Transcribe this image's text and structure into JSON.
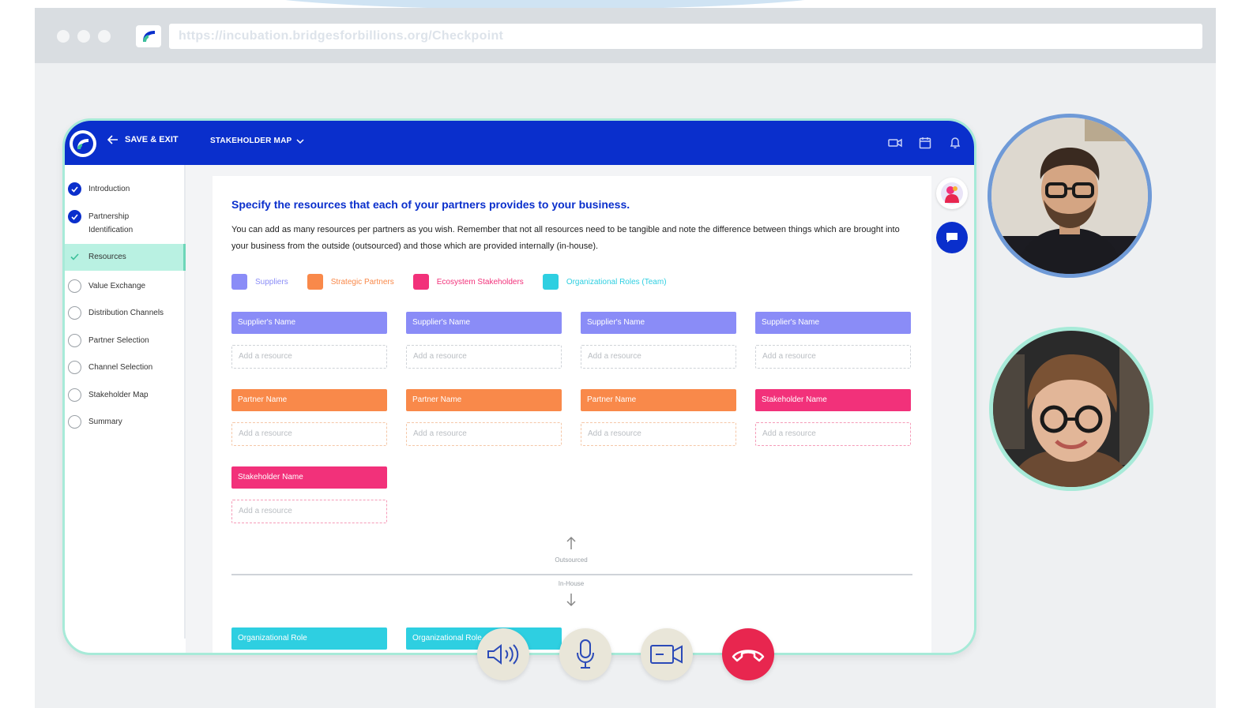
{
  "browser": {
    "url": "https://incubation.bridgesforbillions.org/Checkpoint"
  },
  "header": {
    "save_exit": "SAVE & EXIT",
    "map_title": "STAKEHOLDER MAP"
  },
  "sidebar": {
    "items": [
      {
        "label": "Introduction",
        "state": "done"
      },
      {
        "label": "Partnership Identification",
        "state": "done"
      },
      {
        "label": "Resources",
        "state": "active"
      },
      {
        "label": "Value Exchange",
        "state": "todo"
      },
      {
        "label": "Distribution Channels",
        "state": "todo"
      },
      {
        "label": "Partner Selection",
        "state": "todo"
      },
      {
        "label": "Channel Selection",
        "state": "todo"
      },
      {
        "label": "Stakeholder Map",
        "state": "todo"
      },
      {
        "label": "Summary",
        "state": "todo"
      }
    ]
  },
  "main": {
    "heading": "Specify the resources that each of your partners provides to your business.",
    "description": "You can add as many resources per partners as you wish. Remember that not all resources need to be tangible and note the difference between things which are brought into your business from the outside (outsourced) and those which are provided internally (in-house).",
    "legend": [
      {
        "label": "Suppliers",
        "color": "#8a8cf7"
      },
      {
        "label": "Strategic Partners",
        "color": "#f9894a"
      },
      {
        "label": "Ecosystem Stakeholders",
        "color": "#f2317a"
      },
      {
        "label": "Organizational Roles (Team)",
        "color": "#2ecfe1"
      }
    ],
    "add_resource_placeholder": "Add a resource",
    "cards": {
      "row1": [
        "Supplier's Name",
        "Supplier's Name",
        "Supplier's Name",
        "Supplier's Name"
      ],
      "row2": [
        "Partner Name",
        "Partner Name",
        "Partner Name",
        "Stakeholder Name"
      ],
      "row3": [
        "Stakeholder Name"
      ],
      "row4": [
        "Organizational Role",
        "Organizational Role"
      ]
    },
    "outsourced_label": "Outsourced",
    "inhouse_label": "In-House"
  },
  "colors": {
    "brand_blue": "#0a2fcc",
    "accent_mint": "#a7ead8",
    "hangup_red": "#e8264f"
  },
  "call_controls": [
    "speaker-icon",
    "microphone-icon",
    "camera-icon",
    "hang-up-icon"
  ]
}
